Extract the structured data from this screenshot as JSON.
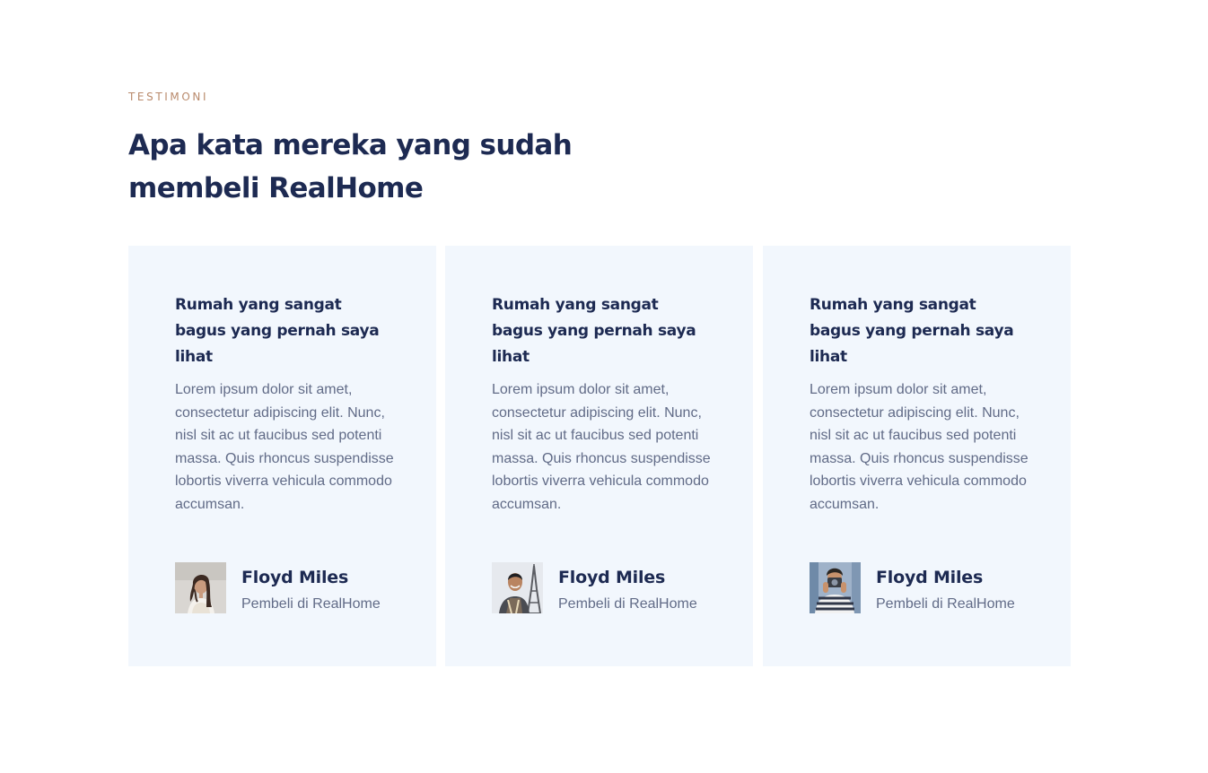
{
  "section": {
    "eyebrow": "TESTIMONI",
    "heading": "Apa kata mereka yang sudah membeli RealHome"
  },
  "colors": {
    "accent": "#b98a6c",
    "heading": "#1d2a52",
    "body_text": "#616b87",
    "card_background": "#f2f7fd"
  },
  "testimonials": [
    {
      "title": "Rumah yang sangat bagus yang pernah saya lihat",
      "body": "Lorem ipsum dolor sit amet, consectetur adipiscing elit. Nunc, nisl sit ac ut faucibus sed potenti massa. Quis rhoncus suspendisse lobortis viverra vehicula commodo accumsan.",
      "name": "Floyd Miles",
      "role": "Pembeli di RealHome",
      "avatar": "woman-photo-avatar"
    },
    {
      "title": "Rumah yang sangat bagus yang pernah saya lihat",
      "body": "Lorem ipsum dolor sit amet, consectetur adipiscing elit. Nunc, nisl sit ac ut faucibus sed potenti massa. Quis rhoncus suspendisse lobortis viverra vehicula commodo accumsan.",
      "name": "Floyd Miles",
      "role": "Pembeli di RealHome",
      "avatar": "man-eiffel-tower-photo-avatar"
    },
    {
      "title": "Rumah yang sangat bagus yang pernah saya lihat",
      "body": "Lorem ipsum dolor sit amet, consectetur adipiscing elit. Nunc, nisl sit ac ut faucibus sed potenti massa. Quis rhoncus suspendisse lobortis viverra vehicula commodo accumsan.",
      "name": "Floyd Miles",
      "role": "Pembeli di RealHome",
      "avatar": "man-with-camera-photo-avatar"
    }
  ]
}
